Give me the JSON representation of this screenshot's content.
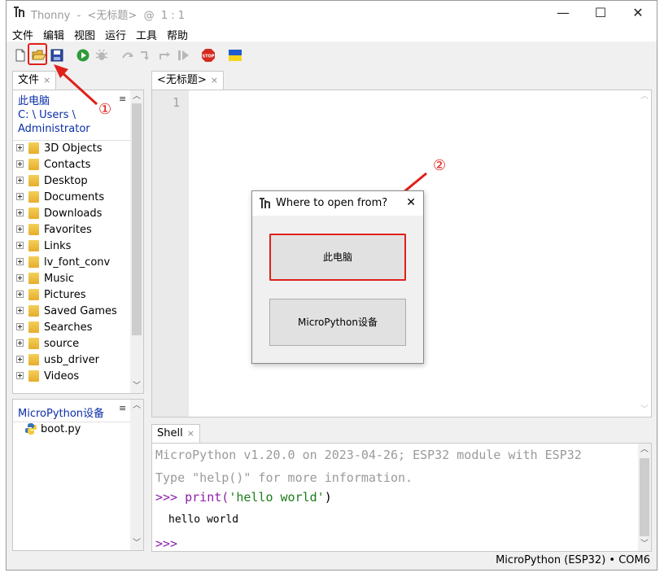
{
  "window": {
    "title": "Thonny  -  <无标题>  @  1 : 1",
    "controls": {
      "minimize": "—",
      "maximize": "☐",
      "close": "✕"
    }
  },
  "menu": [
    "文件",
    "编辑",
    "视图",
    "运行",
    "工具",
    "帮助"
  ],
  "toolbar_icons": [
    "new-file-icon",
    "open-file-icon",
    "save-file-icon",
    "run-icon",
    "debug-icon",
    "step-over-icon",
    "step-into-icon",
    "step-out-icon",
    "resume-icon",
    "stop-icon",
    "ukraine-flag-icon"
  ],
  "files_panel": {
    "tab_label": "文件",
    "tab_close": "×",
    "menu_glyph": "≡",
    "path": [
      "此电脑",
      "C: \\ Users \\",
      "Administrator"
    ],
    "items": [
      "3D Objects",
      "Contacts",
      "Desktop",
      "Documents",
      "Downloads",
      "Favorites",
      "Links",
      "lv_font_conv",
      "Music",
      "Pictures",
      "Saved Games",
      "Searches",
      "source",
      "usb_driver",
      "Videos"
    ],
    "device_header": "MicroPython设备",
    "device_items": [
      "boot.py"
    ]
  },
  "editor": {
    "tab_label": "<无标题>",
    "tab_close": "×",
    "line_numbers": [
      "1"
    ]
  },
  "shell": {
    "tab_label": "Shell",
    "tab_close": "×",
    "banner1": "MicroPython v1.20.0 on 2023-04-26; ESP32 module with ESP32",
    "banner2": "Type \"help()\" for more information.",
    "prompt": ">>>",
    "command_func": "print(",
    "command_str": "'hello world'",
    "command_end": ")",
    "output": "hello world"
  },
  "status": {
    "text": "MicroPython (ESP32)  •  COM6"
  },
  "dialog": {
    "title": "Where to open from?",
    "close": "✕",
    "option_local": "此电脑",
    "option_device": "MicroPython设备"
  },
  "annotations": {
    "step1": "①",
    "step2": "②"
  },
  "colors": {
    "highlight": "#e0201a",
    "path_blue": "#0a2ea8",
    "prompt_purple": "#8a1fa8",
    "string_green": "#1b7d1b"
  }
}
